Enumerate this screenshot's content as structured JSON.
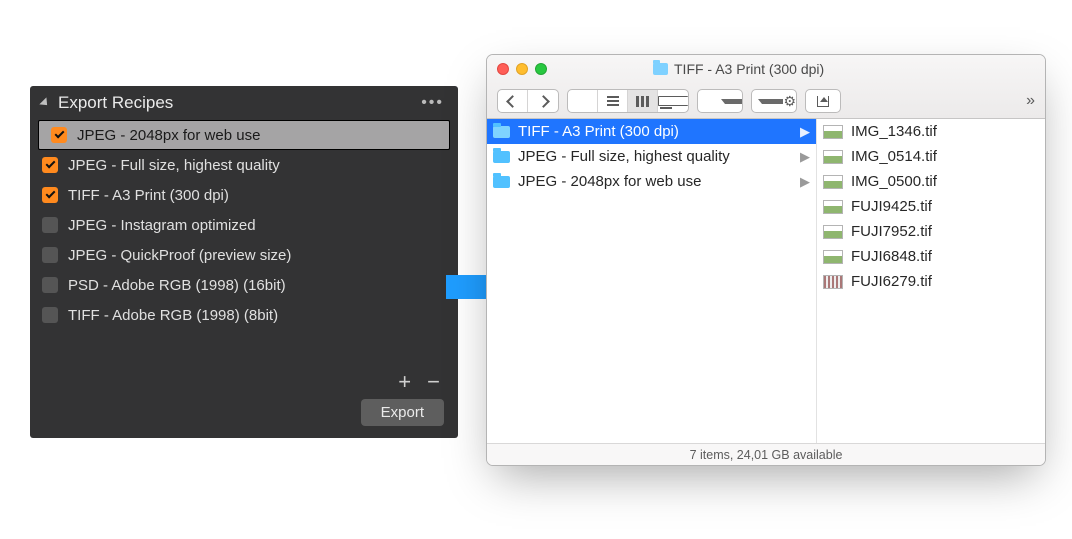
{
  "export": {
    "title": "Export Recipes",
    "recipes": [
      {
        "label": "JPEG - 2048px for web use",
        "checked": true,
        "selected": true
      },
      {
        "label": "JPEG - Full size, highest quality",
        "checked": true,
        "selected": false
      },
      {
        "label": "TIFF - A3 Print (300 dpi)",
        "checked": true,
        "selected": false
      },
      {
        "label": "JPEG - Instagram optimized",
        "checked": false,
        "selected": false
      },
      {
        "label": "JPEG - QuickProof (preview size)",
        "checked": false,
        "selected": false
      },
      {
        "label": "PSD - Adobe RGB (1998) (16bit)",
        "checked": false,
        "selected": false
      },
      {
        "label": "TIFF - Adobe RGB (1998) (8bit)",
        "checked": false,
        "selected": false
      }
    ],
    "export_button": "Export"
  },
  "finder": {
    "window_title": "TIFF - A3 Print (300 dpi)",
    "folders": [
      {
        "name": "TIFF - A3 Print (300 dpi)",
        "selected": true
      },
      {
        "name": "JPEG - Full size, highest quality",
        "selected": false
      },
      {
        "name": "JPEG - 2048px for web use",
        "selected": false
      }
    ],
    "files": [
      {
        "name": "IMG_1346.tif",
        "style": "photo"
      },
      {
        "name": "IMG_0514.tif",
        "style": "photo"
      },
      {
        "name": "IMG_0500.tif",
        "style": "photo"
      },
      {
        "name": "FUJI9425.tif",
        "style": "photo"
      },
      {
        "name": "FUJI7952.tif",
        "style": "photo"
      },
      {
        "name": "FUJI6848.tif",
        "style": "photo"
      },
      {
        "name": "FUJI6279.tif",
        "style": "striped"
      }
    ],
    "status": "7 items, 24,01 GB available"
  }
}
